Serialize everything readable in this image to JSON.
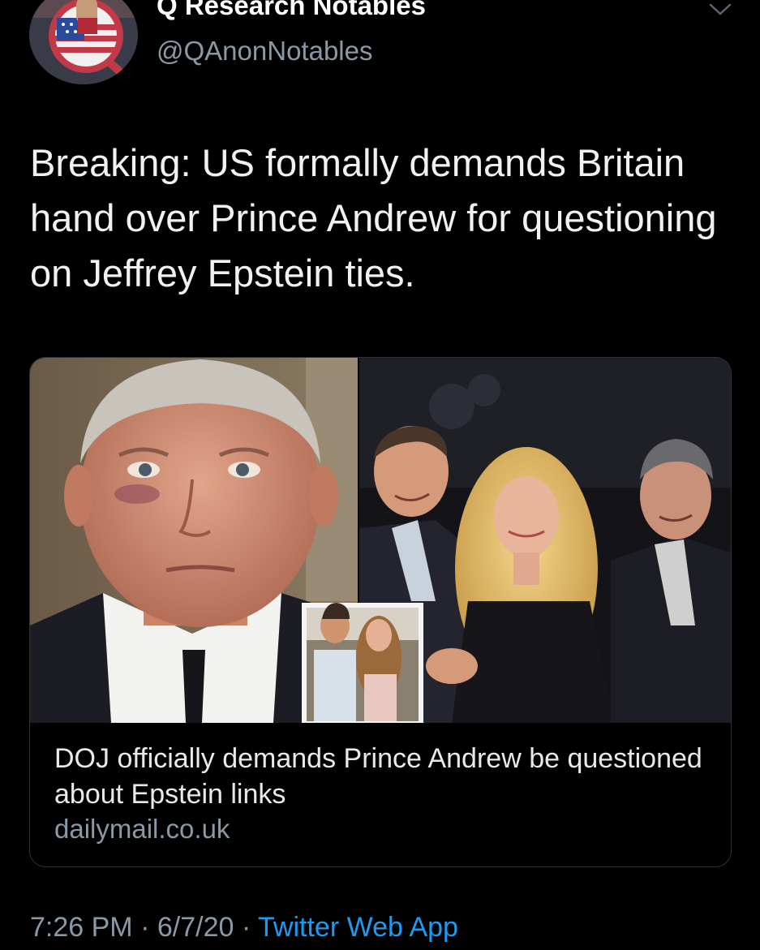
{
  "author": {
    "display_name": "Q Research Notables",
    "handle": "@QAnonNotables",
    "avatar_icon": "q-flag-avatar-icon"
  },
  "tweet": {
    "text": "Breaking: US formally demands Britain hand over Prince Andrew for questioning on Jeffrey Epstein ties."
  },
  "link_card": {
    "title": "DOJ officially demands Prince Andrew be questioned about Epstein links",
    "domain": "dailymail.co.uk"
  },
  "meta": {
    "time": "7:26 PM",
    "separator": "·",
    "date": "6/7/20",
    "source": "Twitter Web App"
  },
  "colors": {
    "background": "#000000",
    "primary_text": "#e7e9ea",
    "secondary_text": "#8b98a5",
    "link": "#1d9bf0",
    "card_border": "#2f3336"
  }
}
